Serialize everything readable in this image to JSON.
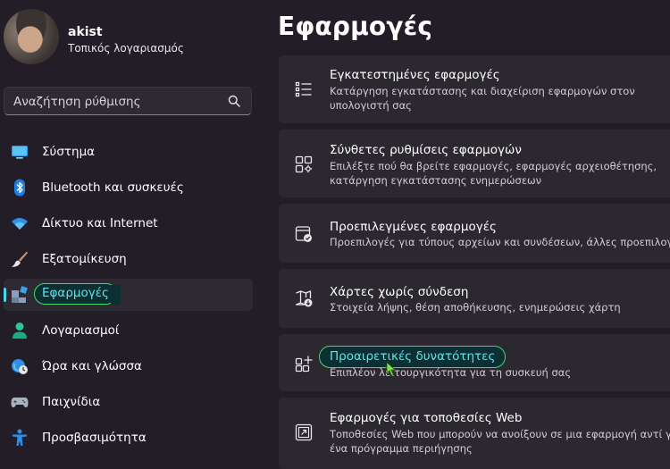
{
  "user": {
    "name": "akist",
    "account_type": "Τοπικός λογαριασμός"
  },
  "search": {
    "placeholder": "Αναζήτηση ρύθμισης"
  },
  "sidebar": {
    "items": [
      {
        "label": "Σύστημα",
        "icon": "monitor-icon"
      },
      {
        "label": "Bluetooth και συσκευές",
        "icon": "bluetooth-icon"
      },
      {
        "label": "Δίκτυο και Internet",
        "icon": "wifi-icon"
      },
      {
        "label": "Εξατομίκευση",
        "icon": "brush-icon"
      },
      {
        "label": "Εφαρμογές",
        "icon": "apps-icon",
        "active": true
      },
      {
        "label": "Λογαριασμοί",
        "icon": "person-icon"
      },
      {
        "label": "Ώρα και γλώσσα",
        "icon": "clock-globe-icon"
      },
      {
        "label": "Παιχνίδια",
        "icon": "gamepad-icon"
      },
      {
        "label": "Προσβασιμότητα",
        "icon": "accessibility-icon"
      }
    ]
  },
  "main": {
    "title": "Εφαρμογές",
    "cards": [
      {
        "title": "Εγκατεστημένες εφαρμογές",
        "desc": [
          "Κατάργηση εγκατάστασης και διαχείριση εφαρμογών στον",
          "υπολογιστή σας"
        ],
        "icon": "list-icon"
      },
      {
        "title": "Σύνθετες ρυθμίσεις εφαρμογών",
        "desc": [
          "Επιλέξτε πού θα βρείτε εφαρμογές, εφαρμογές αρχειοθέτησης,",
          "κατάργηση εγκατάστασης ενημερώσεων"
        ],
        "icon": "apps-gear-icon"
      },
      {
        "title": "Προεπιλεγμένες εφαρμογές",
        "desc": [
          "Προεπιλογές για τύπους αρχείων και συνδέσεων, άλλες προεπιλογές"
        ],
        "icon": "default-apps-icon"
      },
      {
        "title": "Χάρτες χωρίς σύνδεση",
        "desc": [
          "Στοιχεία λήψης, θέση αποθήκευσης, ενημερώσεις χάρτη"
        ],
        "icon": "map-download-icon"
      },
      {
        "title": "Προαιρετικές δυνατότητες",
        "desc": [
          "Επιπλέον λειτουργικότητα για τη συσκευή σας"
        ],
        "icon": "add-grid-icon"
      },
      {
        "title": "Εφαρμογές για τοποθεσίες Web",
        "desc": [
          "Τοποθεσίες Web που μπορούν να ανοίξουν σε μια εφαρμογή αντί για",
          "ένα πρόγραμμα περιήγησης"
        ],
        "icon": "open-web-icon"
      }
    ]
  },
  "colors": {
    "background": "#221d26",
    "card": "#2c2830",
    "accent": "#49d6e8",
    "highlight_ring": "#3ddc6c"
  }
}
